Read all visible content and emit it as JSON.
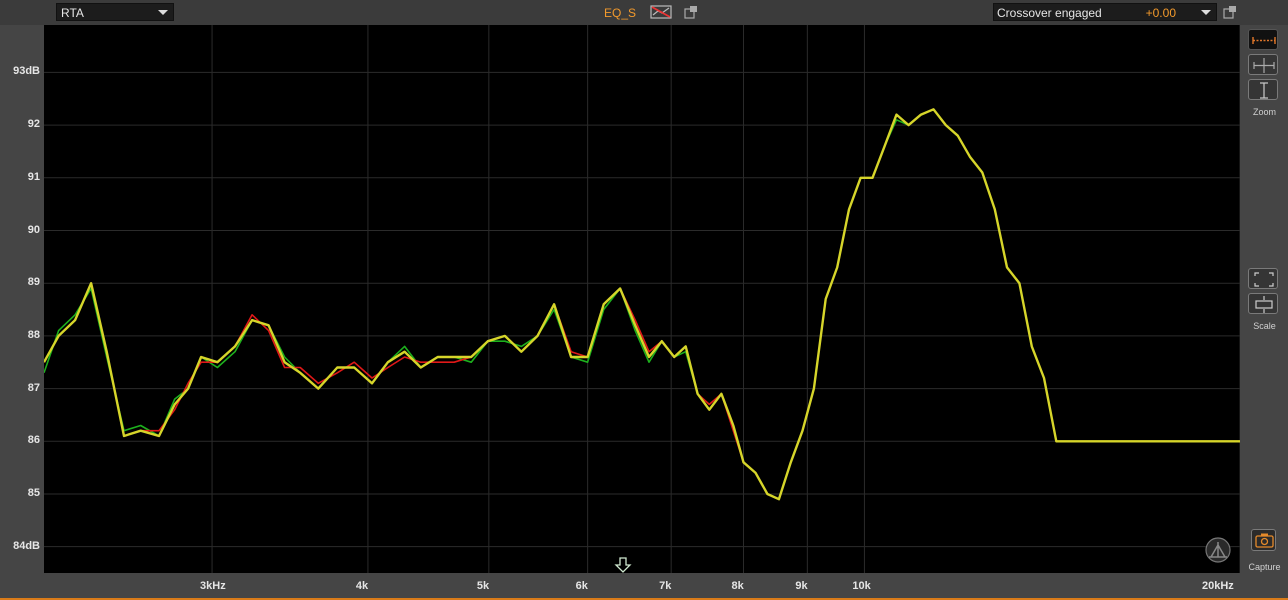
{
  "toolbar": {
    "view_select": {
      "value": "RTA",
      "icon": "chevron-down-icon"
    },
    "eq_label": "EQ_S",
    "crossover": {
      "label": "Crossover engaged",
      "value": "+0.00",
      "icon": "chevron-down-icon"
    }
  },
  "plot": {
    "y_axis": [
      {
        "value": 93,
        "label": "93dB"
      },
      {
        "value": 92,
        "label": "92"
      },
      {
        "value": 91,
        "label": "91"
      },
      {
        "value": 90,
        "label": "90"
      },
      {
        "value": 89,
        "label": "89"
      },
      {
        "value": 88,
        "label": "88"
      },
      {
        "value": 87,
        "label": "87"
      },
      {
        "value": 86,
        "label": "86"
      },
      {
        "value": 85,
        "label": "85"
      },
      {
        "value": 84,
        "label": "84dB"
      }
    ],
    "x_axis": [
      {
        "value": 3000,
        "label": "3kHz"
      },
      {
        "value": 4000,
        "label": "4k"
      },
      {
        "value": 5000,
        "label": "5k"
      },
      {
        "value": 6000,
        "label": "6k"
      },
      {
        "value": 7000,
        "label": "7k"
      },
      {
        "value": 8000,
        "label": "8k"
      },
      {
        "value": 9000,
        "label": "9k"
      },
      {
        "value": 10000,
        "label": "10k"
      },
      {
        "value": 20000,
        "label": "20kHz"
      }
    ],
    "x_range_hz": [
      2200,
      20000
    ],
    "y_range_db": [
      83.5,
      93.9
    ],
    "marker_hz": 6400
  },
  "sidebar": {
    "zoom_label": "Zoom",
    "scale_label": "Scale",
    "capture_label": "Capture"
  },
  "chart_data": {
    "type": "line",
    "xlabel": "",
    "ylabel": "",
    "xscale": "log",
    "grid": true,
    "colors": {
      "green": "#1db01d",
      "red": "#e01818",
      "yellow": "#d6d52a"
    },
    "x": [
      2200,
      2260,
      2330,
      2400,
      2470,
      2550,
      2630,
      2720,
      2800,
      2870,
      2940,
      3030,
      3130,
      3230,
      3330,
      3430,
      3530,
      3650,
      3780,
      3900,
      4030,
      4150,
      4280,
      4410,
      4550,
      4690,
      4840,
      4990,
      5150,
      5310,
      5470,
      5640,
      5820,
      6000,
      6180,
      6370,
      6550,
      6720,
      6880,
      7040,
      7190,
      7350,
      7510,
      7680,
      7850,
      8000,
      8180,
      8360,
      8540,
      8730,
      8920,
      9110,
      9310,
      9510,
      9720,
      9930,
      10150,
      10380,
      10610,
      10850,
      11100,
      11360,
      11620,
      11880,
      12150,
      12430,
      12720,
      13010,
      13310,
      13620,
      13930,
      14250,
      14580,
      14920,
      15270,
      15620,
      15980,
      16350,
      16730,
      17120,
      17520,
      17930,
      18350,
      18780,
      19220,
      19670,
      20000
    ],
    "series": [
      {
        "color": "green",
        "values": [
          87.3,
          88.1,
          88.4,
          88.9,
          87.6,
          86.2,
          86.3,
          86.1,
          86.8,
          87.0,
          87.6,
          87.4,
          87.7,
          88.3,
          88.2,
          87.6,
          87.3,
          87.0,
          87.4,
          87.4,
          87.1,
          87.5,
          87.8,
          87.4,
          87.6,
          87.6,
          87.5,
          87.9,
          87.9,
          87.8,
          88.0,
          88.5,
          87.6,
          87.5,
          88.5,
          88.9,
          88.1,
          87.5,
          87.9,
          87.6,
          87.7,
          86.9,
          86.6,
          86.9,
          86.3,
          85.6,
          85.4,
          85.0,
          84.9,
          85.6,
          86.2,
          87.0,
          88.7,
          89.3,
          90.4,
          91.0,
          91.0,
          91.6,
          92.1,
          92.0,
          92.2,
          92.3,
          92.0,
          91.8,
          91.4,
          91.1,
          90.4,
          89.3,
          89.0,
          87.8,
          87.2,
          86.0,
          86.0,
          86.0,
          86.0,
          86.0,
          86.0,
          86.0,
          86.0,
          86.0,
          86.0,
          86.0,
          86.0,
          86.0,
          86.0,
          86.0,
          86.0
        ]
      },
      {
        "color": "red",
        "values": [
          87.5,
          88.0,
          88.3,
          89.0,
          87.7,
          86.1,
          86.2,
          86.2,
          86.6,
          87.1,
          87.5,
          87.5,
          87.8,
          88.4,
          88.1,
          87.4,
          87.4,
          87.1,
          87.3,
          87.5,
          87.2,
          87.4,
          87.6,
          87.5,
          87.5,
          87.5,
          87.6,
          87.9,
          88.0,
          87.7,
          88.0,
          88.6,
          87.7,
          87.6,
          88.6,
          88.9,
          88.3,
          87.7,
          87.9,
          87.6,
          87.8,
          86.9,
          86.7,
          86.9,
          86.2,
          85.6,
          85.4,
          85.0,
          84.9,
          85.6,
          86.2,
          87.0,
          88.7,
          89.3,
          90.4,
          91.0,
          91.0,
          91.6,
          92.2,
          92.0,
          92.2,
          92.3,
          92.0,
          91.8,
          91.4,
          91.1,
          90.4,
          89.3,
          89.0,
          87.8,
          87.2,
          86.0,
          86.0,
          86.0,
          86.0,
          86.0,
          86.0,
          86.0,
          86.0,
          86.0,
          86.0,
          86.0,
          86.0,
          86.0,
          86.0,
          86.0,
          86.0
        ]
      },
      {
        "color": "yellow",
        "values": [
          87.5,
          88.0,
          88.3,
          89.0,
          87.7,
          86.1,
          86.2,
          86.1,
          86.7,
          87.0,
          87.6,
          87.5,
          87.8,
          88.3,
          88.2,
          87.5,
          87.3,
          87.0,
          87.4,
          87.4,
          87.1,
          87.5,
          87.7,
          87.4,
          87.6,
          87.6,
          87.6,
          87.9,
          88.0,
          87.7,
          88.0,
          88.6,
          87.6,
          87.6,
          88.6,
          88.9,
          88.2,
          87.6,
          87.9,
          87.6,
          87.8,
          86.9,
          86.6,
          86.9,
          86.3,
          85.6,
          85.4,
          85.0,
          84.9,
          85.6,
          86.2,
          87.0,
          88.7,
          89.3,
          90.4,
          91.0,
          91.0,
          91.6,
          92.2,
          92.0,
          92.2,
          92.3,
          92.0,
          91.8,
          91.4,
          91.1,
          90.4,
          89.3,
          89.0,
          87.8,
          87.2,
          86.0,
          86.0,
          86.0,
          86.0,
          86.0,
          86.0,
          86.0,
          86.0,
          86.0,
          86.0,
          86.0,
          86.0,
          86.0,
          86.0,
          86.0,
          86.0
        ]
      }
    ]
  }
}
